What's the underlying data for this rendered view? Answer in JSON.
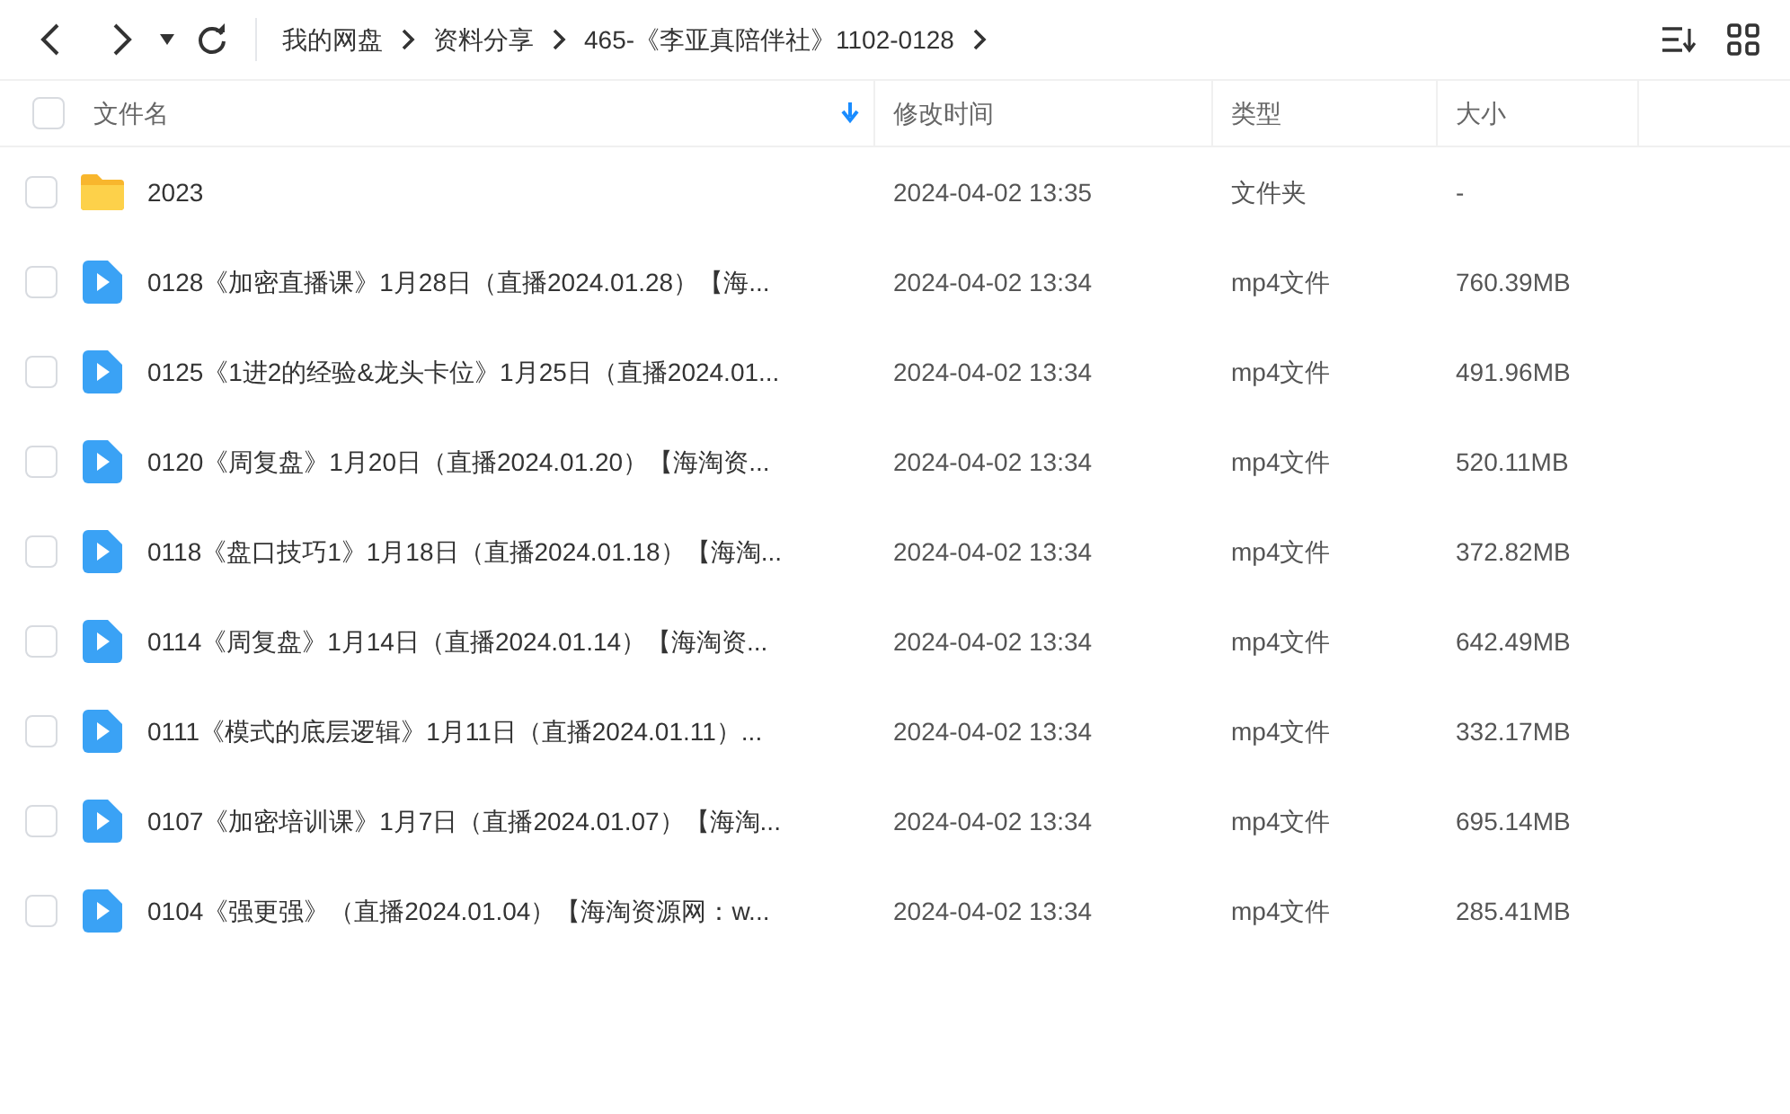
{
  "breadcrumb": [
    "我的网盘",
    "资料分享",
    "465-《李亚真陪伴社》1102-0128"
  ],
  "header": {
    "checked": false
  },
  "columns": [
    {
      "label": "文件名",
      "sorted": true
    },
    {
      "label": "修改时间",
      "sorted": false
    },
    {
      "label": "类型",
      "sorted": false
    },
    {
      "label": "大小",
      "sorted": false
    }
  ],
  "rows": [
    {
      "kind": "folder",
      "name": "2023",
      "modified": "2024-04-02 13:35",
      "type": "文件夹",
      "size": "-",
      "checked": false
    },
    {
      "kind": "video",
      "name": "0128《加密直播课》1月28日（直播2024.01.28）【海...",
      "modified": "2024-04-02 13:34",
      "type": "mp4文件",
      "size": "760.39MB",
      "checked": false
    },
    {
      "kind": "video",
      "name": "0125《1进2的经验&龙头卡位》1月25日（直播2024.01...",
      "modified": "2024-04-02 13:34",
      "type": "mp4文件",
      "size": "491.96MB",
      "checked": false
    },
    {
      "kind": "video",
      "name": "0120《周复盘》1月20日（直播2024.01.20）【海淘资...",
      "modified": "2024-04-02 13:34",
      "type": "mp4文件",
      "size": "520.11MB",
      "checked": false
    },
    {
      "kind": "video",
      "name": "0118《盘口技巧1》1月18日（直播2024.01.18）【海淘...",
      "modified": "2024-04-02 13:34",
      "type": "mp4文件",
      "size": "372.82MB",
      "checked": false
    },
    {
      "kind": "video",
      "name": "0114《周复盘》1月14日（直播2024.01.14）【海淘资...",
      "modified": "2024-04-02 13:34",
      "type": "mp4文件",
      "size": "642.49MB",
      "checked": false
    },
    {
      "kind": "video",
      "name": "0111《模式的底层逻辑》1月11日（直播2024.01.11）...",
      "modified": "2024-04-02 13:34",
      "type": "mp4文件",
      "size": "332.17MB",
      "checked": false
    },
    {
      "kind": "video",
      "name": "0107《加密培训课》1月7日（直播2024.01.07）【海淘...",
      "modified": "2024-04-02 13:34",
      "type": "mp4文件",
      "size": "695.14MB",
      "checked": false
    },
    {
      "kind": "video",
      "name": "0104《强更强》（直播2024.01.04）【海淘资源网：w...",
      "modified": "2024-04-02 13:34",
      "type": "mp4文件",
      "size": "285.41MB",
      "checked": false
    }
  ]
}
